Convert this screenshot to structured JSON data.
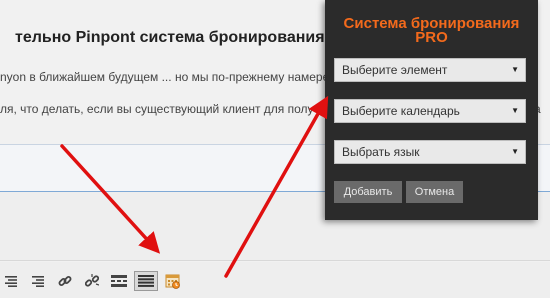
{
  "article": {
    "heading": "тельно Pinpont система бронирования :)",
    "line1": "nyon в ближайшем будущем ... но мы по-прежнему намерен",
    "line2": "ля, что делать, если вы существующий клиент для получе",
    "line2_tail": "а"
  },
  "popup": {
    "title_line1": "Система бронирования",
    "title_line2": "PRO",
    "select_element": "Выберите элемент",
    "select_calendar": "Выберите календарь",
    "select_language": "Выбрать язык",
    "add_label": "Добавить",
    "cancel_label": "Отмена"
  },
  "colors": {
    "popup_background": "#2b2b2b",
    "title_color": "#f36a1c",
    "arrow_color": "#e01010"
  },
  "toolbar": {
    "icons": [
      "align-center-icon",
      "align-right-icon",
      "link-icon",
      "unlink-icon",
      "read-more-icon",
      "toolbar-toggle-icon",
      "booking-calendar-icon"
    ]
  }
}
